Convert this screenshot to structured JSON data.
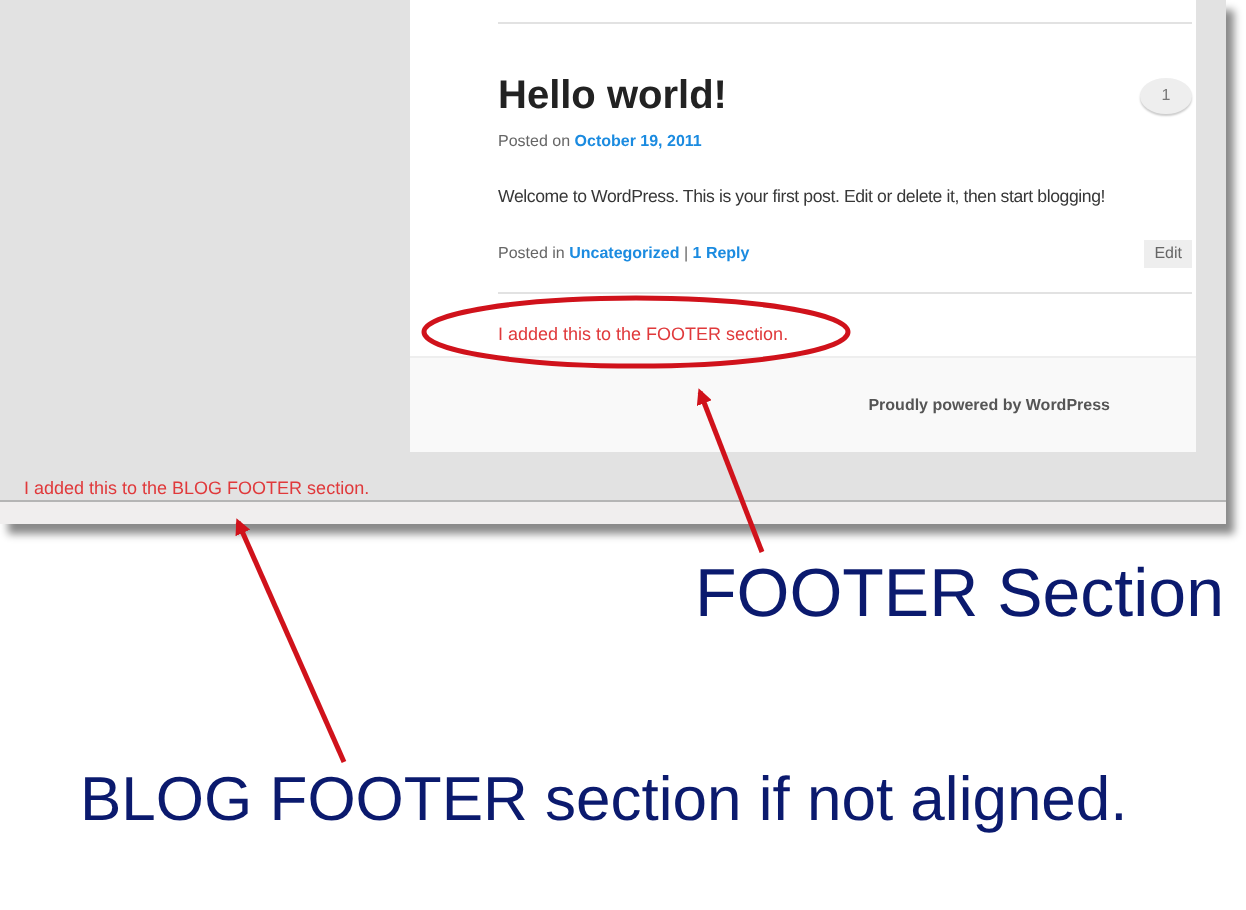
{
  "post": {
    "title": "Hello world!",
    "comment_count": "1",
    "posted_on_label": "Posted on",
    "date": "October 19, 2011",
    "body": "Welcome to WordPress. This is your first post. Edit or delete it, then start blogging!",
    "posted_in_label": "Posted in",
    "category": "Uncategorized",
    "separator": "|",
    "replies": "1 Reply",
    "edit": "Edit"
  },
  "footer_note": "I added this to the FOOTER section.",
  "credit": "Proudly powered by WordPress",
  "blog_footer_note": "I added this to the BLOG FOOTER section.",
  "annotations": [
    {
      "label": "FOOTER Section"
    },
    {
      "label": "BLOG FOOTER section if not aligned."
    }
  ]
}
